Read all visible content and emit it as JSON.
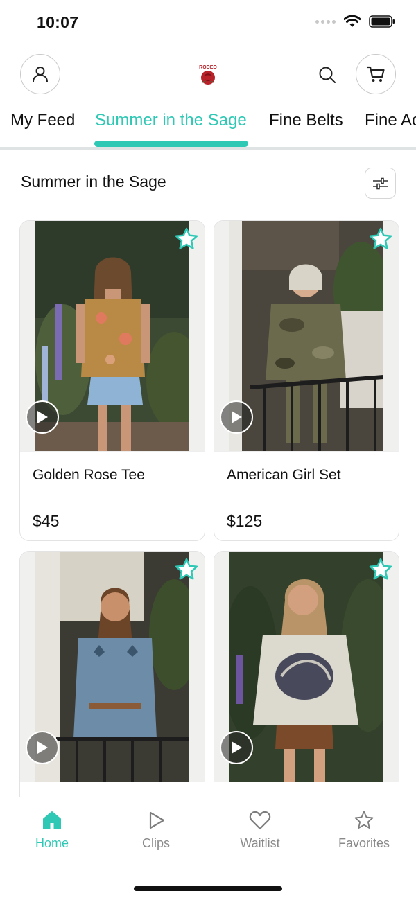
{
  "status_bar": {
    "time": "10:07"
  },
  "header": {
    "profile_icon": "user-icon",
    "search_icon": "search-icon",
    "cart_icon": "cart-icon",
    "logo": "brand-rose-logo",
    "logo_text": "RODEO"
  },
  "tabs": [
    {
      "label": "My Feed",
      "active": false
    },
    {
      "label": "Summer in the Sage",
      "active": true
    },
    {
      "label": "Fine Belts",
      "active": false
    },
    {
      "label": "Fine Ac",
      "active": false
    }
  ],
  "section": {
    "title": "Summer in the Sage",
    "filter_icon": "sliders-icon"
  },
  "products": [
    {
      "name": "Golden Rose Tee",
      "price": "$45",
      "favorited": false,
      "has_video": true
    },
    {
      "name": "American Girl Set",
      "price": "$125",
      "favorited": false,
      "has_video": true
    },
    {
      "name": "",
      "price": "",
      "favorited": false,
      "has_video": true
    },
    {
      "name": "",
      "price": "",
      "favorited": false,
      "has_video": true
    }
  ],
  "bottom_nav": [
    {
      "label": "Home",
      "icon": "home-icon",
      "active": true
    },
    {
      "label": "Clips",
      "icon": "play-icon",
      "active": false
    },
    {
      "label": "Waitlist",
      "icon": "heart-icon",
      "active": false
    },
    {
      "label": "Favorites",
      "icon": "star-icon",
      "active": false
    }
  ],
  "colors": {
    "accent": "#2fc8b5",
    "inactive": "#8a8a8a",
    "divider": "#dfe3e4"
  }
}
